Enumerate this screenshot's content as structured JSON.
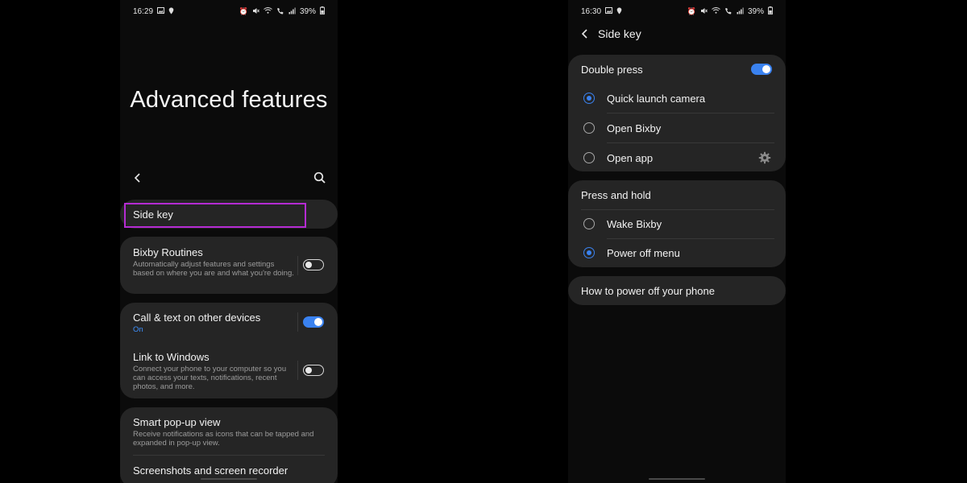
{
  "left": {
    "status": {
      "time": "16:29",
      "battery": "39%"
    },
    "title": "Advanced features",
    "side_key": {
      "label": "Side key"
    },
    "bixby_routines": {
      "title": "Bixby Routines",
      "desc": "Automatically adjust features and settings based on where you are and what you're doing.",
      "toggle": "off"
    },
    "call_text": {
      "title": "Call & text on other devices",
      "status": "On",
      "toggle": "on"
    },
    "link_windows": {
      "title": "Link to Windows",
      "desc": "Connect your phone to your computer so you can access your texts, notifications, recent photos, and more.",
      "toggle": "off"
    },
    "smart_popup": {
      "title": "Smart pop-up view",
      "desc": "Receive notifications as icons that can be tapped and expanded in pop-up view."
    },
    "screenshots": {
      "title": "Screenshots and screen recorder"
    }
  },
  "right": {
    "status": {
      "time": "16:30",
      "battery": "39%"
    },
    "header_title": "Side key",
    "double_press": {
      "title": "Double press",
      "toggle": "on",
      "options": [
        {
          "label": "Quick launch camera",
          "selected": true
        },
        {
          "label": "Open Bixby",
          "selected": false
        },
        {
          "label": "Open app",
          "selected": false
        }
      ]
    },
    "press_hold": {
      "title": "Press and hold",
      "options": [
        {
          "label": "Wake Bixby",
          "selected": false
        },
        {
          "label": "Power off menu",
          "selected": true
        }
      ]
    },
    "power_off_link": "How to power off your phone"
  },
  "colors": {
    "accent": "#3a82f0",
    "highlight": "#b52bd3",
    "card": "#252525",
    "background": "#0b0b0b"
  },
  "icons": [
    "image-icon",
    "location-icon",
    "alarm-icon",
    "mute-icon",
    "wifi-icon",
    "wifi-calling-icon",
    "signal-icon",
    "battery-icon",
    "back-arrow-icon",
    "search-icon",
    "settings-gear-icon"
  ]
}
